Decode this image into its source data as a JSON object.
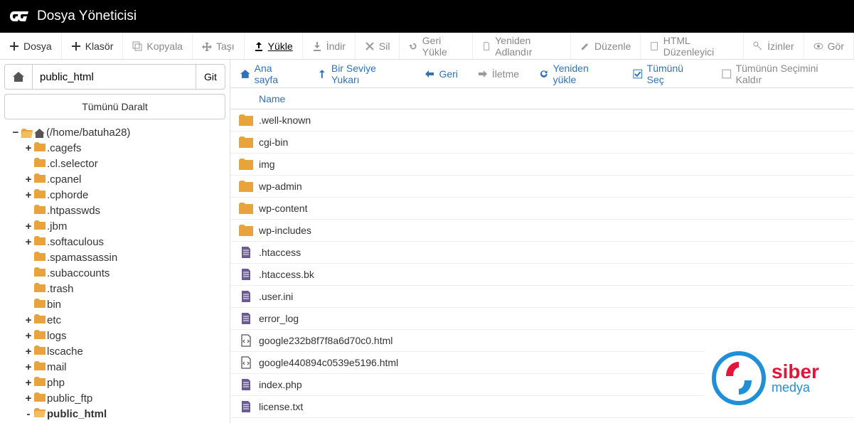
{
  "header": {
    "title": "Dosya Yöneticisi"
  },
  "toolbar": {
    "file": "Dosya",
    "folder": "Klasör",
    "copy": "Kopyala",
    "move": "Taşı",
    "upload": "Yükle",
    "download": "İndir",
    "delete": "Sil",
    "restore": "Geri Yükle",
    "rename": "Yeniden Adlandır",
    "edit": "Düzenle",
    "html_edit": "HTML Düzenleyici",
    "permissions": "İzinler",
    "view": "Gör"
  },
  "sidebar": {
    "path_value": "public_html",
    "go_label": "Git",
    "collapse_all": "Tümünü Daralt",
    "root_label": "(/home/batuha28)",
    "tree": [
      {
        "toggle": "+",
        "label": ".cagefs"
      },
      {
        "toggle": "",
        "label": ".cl.selector"
      },
      {
        "toggle": "+",
        "label": ".cpanel"
      },
      {
        "toggle": "+",
        "label": ".cphorde"
      },
      {
        "toggle": "",
        "label": ".htpasswds"
      },
      {
        "toggle": "+",
        "label": ".jbm"
      },
      {
        "toggle": "+",
        "label": ".softaculous"
      },
      {
        "toggle": "",
        "label": ".spamassassin"
      },
      {
        "toggle": "",
        "label": ".subaccounts"
      },
      {
        "toggle": "",
        "label": ".trash"
      },
      {
        "toggle": "",
        "label": "bin"
      },
      {
        "toggle": "+",
        "label": "etc"
      },
      {
        "toggle": "+",
        "label": "logs"
      },
      {
        "toggle": "+",
        "label": "lscache"
      },
      {
        "toggle": "+",
        "label": "mail"
      },
      {
        "toggle": "+",
        "label": "php"
      },
      {
        "toggle": "+",
        "label": "public_ftp"
      },
      {
        "toggle": "-",
        "label": "public_html",
        "bold": true,
        "open": true
      }
    ]
  },
  "actionbar": {
    "home": "Ana sayfa",
    "up": "Bir Seviye Yukarı",
    "back": "Geri",
    "forward": "İletme",
    "reload": "Yeniden yükle",
    "select_all": "Tümünü Seç",
    "deselect_all": "Tümünün Seçimini Kaldır"
  },
  "table": {
    "col_name": "Name",
    "rows": [
      {
        "type": "folder",
        "name": ".well-known"
      },
      {
        "type": "folder",
        "name": "cgi-bin"
      },
      {
        "type": "folder",
        "name": "img"
      },
      {
        "type": "folder",
        "name": "wp-admin"
      },
      {
        "type": "folder",
        "name": "wp-content"
      },
      {
        "type": "folder",
        "name": "wp-includes"
      },
      {
        "type": "file",
        "name": ".htaccess"
      },
      {
        "type": "file",
        "name": ".htaccess.bk"
      },
      {
        "type": "file",
        "name": ".user.ini"
      },
      {
        "type": "file",
        "name": "error_log"
      },
      {
        "type": "code",
        "name": "google232b8f7f8a6d70c0.html"
      },
      {
        "type": "code",
        "name": "google440894c0539e5196.html"
      },
      {
        "type": "file",
        "name": "index.php"
      },
      {
        "type": "file",
        "name": "license.txt"
      }
    ]
  },
  "watermark": {
    "line1": "siber",
    "line2": "medya"
  }
}
